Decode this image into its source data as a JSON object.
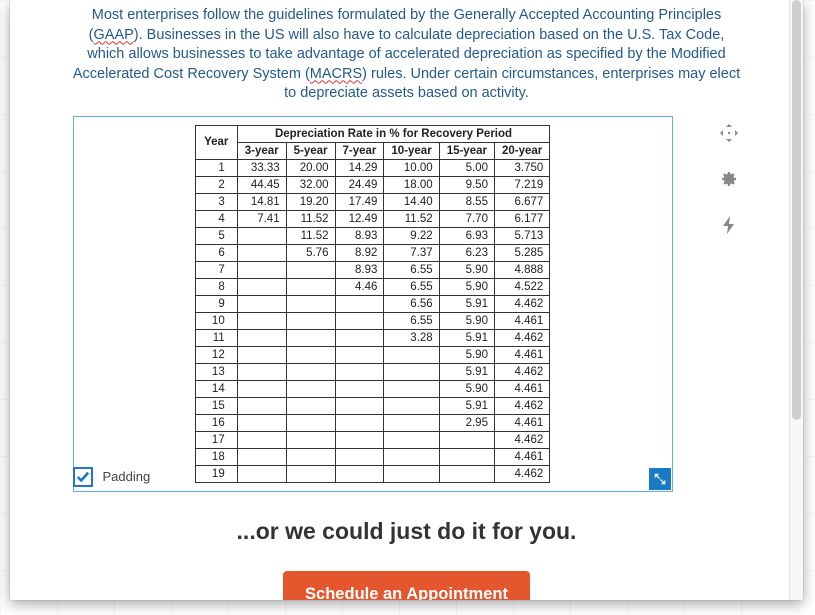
{
  "intro": {
    "text_parts": [
      "Most enterprises follow the guidelines formulated by the Generally Accepted Accounting Principles (",
      "GAAP",
      "). Businesses in the US will also have to calculate depreciation based on the U.S. Tax Code, which allows businesses to take advantage of accelerated depreciation as specified by the Modified Accelerated Cost Recovery System (",
      "MACRS",
      ") rules. Under certain circumstances, enterprises may elect to depreciate assets based on activity."
    ]
  },
  "table": {
    "header_top": "Depreciation Rate in % for Recovery Period",
    "year_label": "Year",
    "columns": [
      "3-year",
      "5-year",
      "7-year",
      "10-year",
      "15-year",
      "20-year"
    ],
    "rows": [
      {
        "year": "1",
        "cells": [
          "33.33",
          "20.00",
          "14.29",
          "10.00",
          "5.00",
          "3.750"
        ]
      },
      {
        "year": "2",
        "cells": [
          "44.45",
          "32.00",
          "24.49",
          "18.00",
          "9.50",
          "7.219"
        ]
      },
      {
        "year": "3",
        "cells": [
          "14.81",
          "19.20",
          "17.49",
          "14.40",
          "8.55",
          "6.677"
        ]
      },
      {
        "year": "4",
        "cells": [
          "7.41",
          "11.52",
          "12.49",
          "11.52",
          "7.70",
          "6.177"
        ]
      },
      {
        "year": "5",
        "cells": [
          "",
          "11.52",
          "8.93",
          "9.22",
          "6.93",
          "5.713"
        ]
      },
      {
        "year": "6",
        "cells": [
          "",
          "5.76",
          "8.92",
          "7.37",
          "6.23",
          "5.285"
        ]
      },
      {
        "year": "7",
        "cells": [
          "",
          "",
          "8.93",
          "6.55",
          "5.90",
          "4.888"
        ]
      },
      {
        "year": "8",
        "cells": [
          "",
          "",
          "4.46",
          "6.55",
          "5.90",
          "4.522"
        ]
      },
      {
        "year": "9",
        "cells": [
          "",
          "",
          "",
          "6.56",
          "5.91",
          "4.462"
        ]
      },
      {
        "year": "10",
        "cells": [
          "",
          "",
          "",
          "6.55",
          "5.90",
          "4.461"
        ]
      },
      {
        "year": "11",
        "cells": [
          "",
          "",
          "",
          "3.28",
          "5.91",
          "4.462"
        ]
      },
      {
        "year": "12",
        "cells": [
          "",
          "",
          "",
          "",
          "5.90",
          "4.461"
        ]
      },
      {
        "year": "13",
        "cells": [
          "",
          "",
          "",
          "",
          "5.91",
          "4.462"
        ]
      },
      {
        "year": "14",
        "cells": [
          "",
          "",
          "",
          "",
          "5.90",
          "4.461"
        ]
      },
      {
        "year": "15",
        "cells": [
          "",
          "",
          "",
          "",
          "5.91",
          "4.462"
        ]
      },
      {
        "year": "16",
        "cells": [
          "",
          "",
          "",
          "",
          "2.95",
          "4.461"
        ]
      },
      {
        "year": "17",
        "cells": [
          "",
          "",
          "",
          "",
          "",
          "4.462"
        ]
      },
      {
        "year": "18",
        "cells": [
          "",
          "",
          "",
          "",
          "",
          "4.461"
        ]
      },
      {
        "year": "19",
        "cells": [
          "",
          "",
          "",
          "",
          "",
          "4.462"
        ]
      }
    ]
  },
  "padding_toggle": {
    "label": "Padding",
    "checked": true
  },
  "tools": {
    "move": "move-icon",
    "settings": "gear-icon",
    "flash": "bolt-icon"
  },
  "cta": {
    "line": "...or we could just do it for you.",
    "button": "Schedule an Appointment"
  },
  "colors": {
    "brand_blue": "#1b7ac5",
    "text_blue": "#235a8c",
    "cta_orange": "#e4572e"
  }
}
